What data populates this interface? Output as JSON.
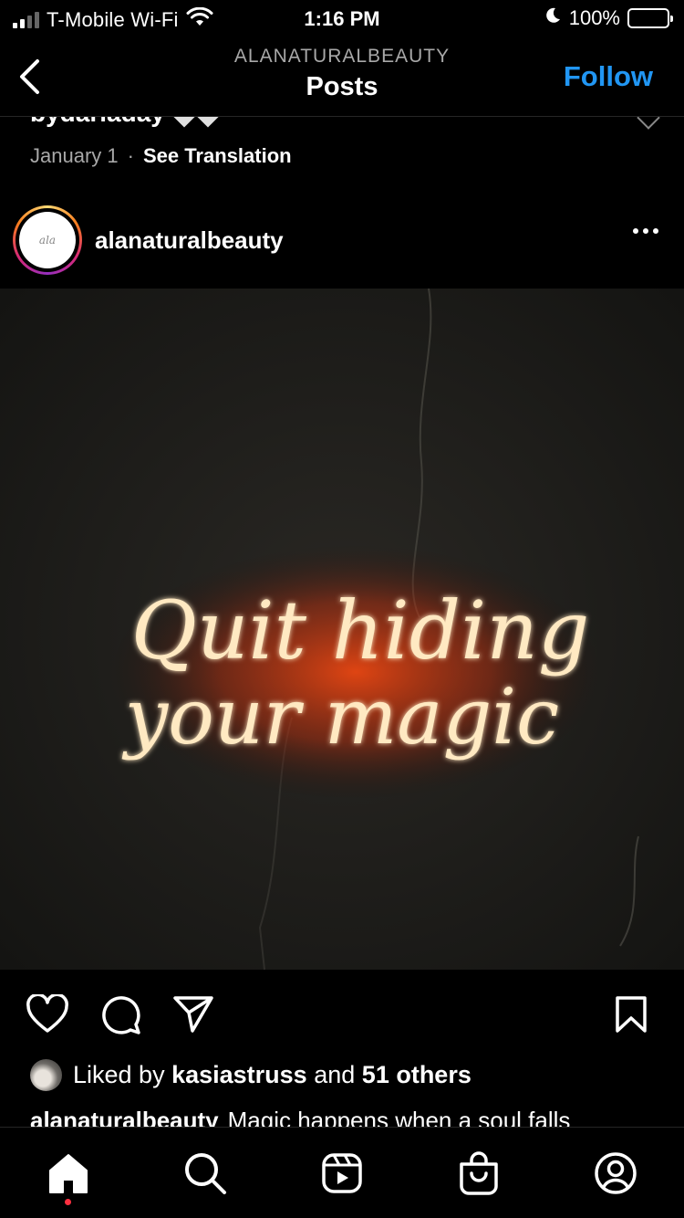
{
  "status_bar": {
    "carrier": "T-Mobile Wi-Fi",
    "time": "1:16 PM",
    "battery": "100%"
  },
  "header": {
    "account": "ALANATURALBEAUTY",
    "title": "Posts",
    "follow_label": "Follow"
  },
  "previous_post": {
    "caption_fragment": "bydarladay",
    "date": "January 1",
    "separator": "·",
    "see_translation": "See Translation"
  },
  "post": {
    "username": "alanaturalbeauty",
    "avatar_text": "ala",
    "image_text_line1": "Quit hiding",
    "image_text_line2": "your magic",
    "likes_prefix": "Liked by",
    "liked_by_user": "kasiastruss",
    "likes_and": "and",
    "likes_others": "51 others",
    "caption_username": "alanaturalbeauty",
    "caption_text": "Magic happens when a soul falls"
  },
  "tab_bar": {
    "items": [
      "home-icon",
      "search-icon",
      "reels-icon",
      "shop-icon",
      "profile-icon"
    ],
    "active": "home-icon"
  },
  "colors": {
    "accent_blue": "#2196f3",
    "neon_core": "#ffe9c2",
    "neon_glow": "#ff5a1f",
    "notification_dot": "#ff3040",
    "battery_green": "#4cd964"
  }
}
